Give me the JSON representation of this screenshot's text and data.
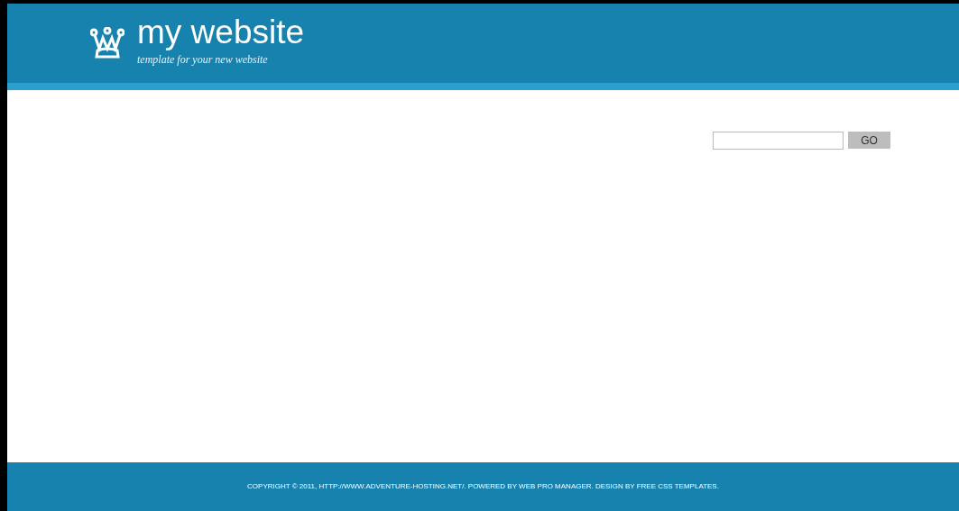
{
  "header": {
    "title": "my website",
    "tagline": "template for your new website"
  },
  "search": {
    "button": "GO"
  },
  "footer": {
    "text": "COPYRIGHT © 2011, HTTP://WWW.ADVENTURE-HOSTING.NET/. POWERED BY WEB PRO MANAGER. DESIGN BY FREE CSS TEMPLATES."
  }
}
